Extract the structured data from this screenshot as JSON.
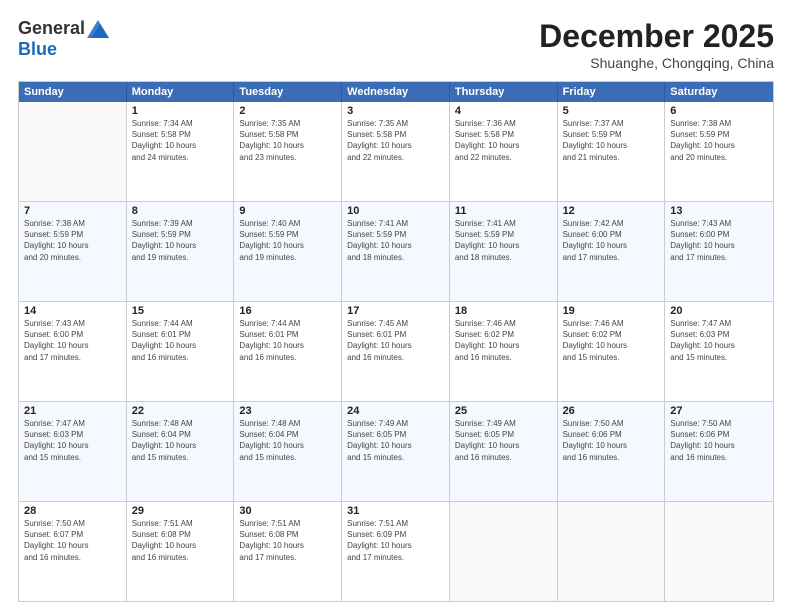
{
  "header": {
    "logo_general": "General",
    "logo_blue": "Blue",
    "main_title": "December 2025",
    "subtitle": "Shuanghe, Chongqing, China"
  },
  "weekdays": [
    "Sunday",
    "Monday",
    "Tuesday",
    "Wednesday",
    "Thursday",
    "Friday",
    "Saturday"
  ],
  "rows": [
    [
      {
        "day": "",
        "info": ""
      },
      {
        "day": "1",
        "info": "Sunrise: 7:34 AM\nSunset: 5:58 PM\nDaylight: 10 hours\nand 24 minutes."
      },
      {
        "day": "2",
        "info": "Sunrise: 7:35 AM\nSunset: 5:58 PM\nDaylight: 10 hours\nand 23 minutes."
      },
      {
        "day": "3",
        "info": "Sunrise: 7:35 AM\nSunset: 5:58 PM\nDaylight: 10 hours\nand 22 minutes."
      },
      {
        "day": "4",
        "info": "Sunrise: 7:36 AM\nSunset: 5:58 PM\nDaylight: 10 hours\nand 22 minutes."
      },
      {
        "day": "5",
        "info": "Sunrise: 7:37 AM\nSunset: 5:59 PM\nDaylight: 10 hours\nand 21 minutes."
      },
      {
        "day": "6",
        "info": "Sunrise: 7:38 AM\nSunset: 5:59 PM\nDaylight: 10 hours\nand 20 minutes."
      }
    ],
    [
      {
        "day": "7",
        "info": "Sunrise: 7:38 AM\nSunset: 5:59 PM\nDaylight: 10 hours\nand 20 minutes."
      },
      {
        "day": "8",
        "info": "Sunrise: 7:39 AM\nSunset: 5:59 PM\nDaylight: 10 hours\nand 19 minutes."
      },
      {
        "day": "9",
        "info": "Sunrise: 7:40 AM\nSunset: 5:59 PM\nDaylight: 10 hours\nand 19 minutes."
      },
      {
        "day": "10",
        "info": "Sunrise: 7:41 AM\nSunset: 5:59 PM\nDaylight: 10 hours\nand 18 minutes."
      },
      {
        "day": "11",
        "info": "Sunrise: 7:41 AM\nSunset: 5:59 PM\nDaylight: 10 hours\nand 18 minutes."
      },
      {
        "day": "12",
        "info": "Sunrise: 7:42 AM\nSunset: 6:00 PM\nDaylight: 10 hours\nand 17 minutes."
      },
      {
        "day": "13",
        "info": "Sunrise: 7:43 AM\nSunset: 6:00 PM\nDaylight: 10 hours\nand 17 minutes."
      }
    ],
    [
      {
        "day": "14",
        "info": "Sunrise: 7:43 AM\nSunset: 6:00 PM\nDaylight: 10 hours\nand 17 minutes."
      },
      {
        "day": "15",
        "info": "Sunrise: 7:44 AM\nSunset: 6:01 PM\nDaylight: 10 hours\nand 16 minutes."
      },
      {
        "day": "16",
        "info": "Sunrise: 7:44 AM\nSunset: 6:01 PM\nDaylight: 10 hours\nand 16 minutes."
      },
      {
        "day": "17",
        "info": "Sunrise: 7:45 AM\nSunset: 6:01 PM\nDaylight: 10 hours\nand 16 minutes."
      },
      {
        "day": "18",
        "info": "Sunrise: 7:46 AM\nSunset: 6:02 PM\nDaylight: 10 hours\nand 16 minutes."
      },
      {
        "day": "19",
        "info": "Sunrise: 7:46 AM\nSunset: 6:02 PM\nDaylight: 10 hours\nand 15 minutes."
      },
      {
        "day": "20",
        "info": "Sunrise: 7:47 AM\nSunset: 6:03 PM\nDaylight: 10 hours\nand 15 minutes."
      }
    ],
    [
      {
        "day": "21",
        "info": "Sunrise: 7:47 AM\nSunset: 6:03 PM\nDaylight: 10 hours\nand 15 minutes."
      },
      {
        "day": "22",
        "info": "Sunrise: 7:48 AM\nSunset: 6:04 PM\nDaylight: 10 hours\nand 15 minutes."
      },
      {
        "day": "23",
        "info": "Sunrise: 7:48 AM\nSunset: 6:04 PM\nDaylight: 10 hours\nand 15 minutes."
      },
      {
        "day": "24",
        "info": "Sunrise: 7:49 AM\nSunset: 6:05 PM\nDaylight: 10 hours\nand 15 minutes."
      },
      {
        "day": "25",
        "info": "Sunrise: 7:49 AM\nSunset: 6:05 PM\nDaylight: 10 hours\nand 16 minutes."
      },
      {
        "day": "26",
        "info": "Sunrise: 7:50 AM\nSunset: 6:06 PM\nDaylight: 10 hours\nand 16 minutes."
      },
      {
        "day": "27",
        "info": "Sunrise: 7:50 AM\nSunset: 6:06 PM\nDaylight: 10 hours\nand 16 minutes."
      }
    ],
    [
      {
        "day": "28",
        "info": "Sunrise: 7:50 AM\nSunset: 6:07 PM\nDaylight: 10 hours\nand 16 minutes."
      },
      {
        "day": "29",
        "info": "Sunrise: 7:51 AM\nSunset: 6:08 PM\nDaylight: 10 hours\nand 16 minutes."
      },
      {
        "day": "30",
        "info": "Sunrise: 7:51 AM\nSunset: 6:08 PM\nDaylight: 10 hours\nand 17 minutes."
      },
      {
        "day": "31",
        "info": "Sunrise: 7:51 AM\nSunset: 6:09 PM\nDaylight: 10 hours\nand 17 minutes."
      },
      {
        "day": "",
        "info": ""
      },
      {
        "day": "",
        "info": ""
      },
      {
        "day": "",
        "info": ""
      }
    ]
  ]
}
